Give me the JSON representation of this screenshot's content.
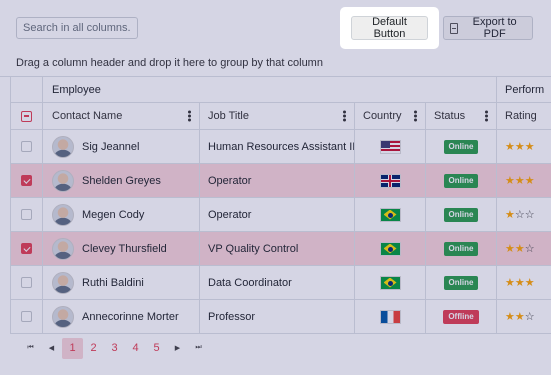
{
  "toolbar": {
    "search_placeholder": "Search in all columns...",
    "default_button_label": "Default Button",
    "export_label": "Export to PDF"
  },
  "group_panel_text": "Drag a column header and drop it here to group by that column",
  "bands": {
    "employee": "Employee",
    "performance": "Perform"
  },
  "columns": {
    "contact_name": "Contact Name",
    "job_title": "Job Title",
    "country": "Country",
    "status": "Status",
    "rating": "Rating"
  },
  "rows": [
    {
      "name": "Sig Jeannel",
      "job": "Human Resources Assistant III",
      "country": "us",
      "status": "Online",
      "rating": 3,
      "selected": false
    },
    {
      "name": "Shelden Greyes",
      "job": "Operator",
      "country": "gb",
      "status": "Online",
      "rating": 3,
      "selected": true
    },
    {
      "name": "Megen Cody",
      "job": "Operator",
      "country": "br",
      "status": "Online",
      "rating": 1,
      "selected": false
    },
    {
      "name": "Clevey Thursfield",
      "job": "VP Quality Control",
      "country": "br",
      "status": "Online",
      "rating": 2,
      "selected": true
    },
    {
      "name": "Ruthi Baldini",
      "job": "Data Coordinator",
      "country": "br",
      "status": "Online",
      "rating": 3,
      "selected": false
    },
    {
      "name": "Annecorinne Morter",
      "job": "Professor",
      "country": "fr",
      "status": "Offline",
      "rating": 2,
      "selected": false
    }
  ],
  "status_colors": {
    "Online": "#2a9d4a",
    "Offline": "#e43f52"
  },
  "accent_color": "#e43f52",
  "pager": {
    "pages": [
      "1",
      "2",
      "3",
      "4",
      "5"
    ],
    "current": "1"
  }
}
